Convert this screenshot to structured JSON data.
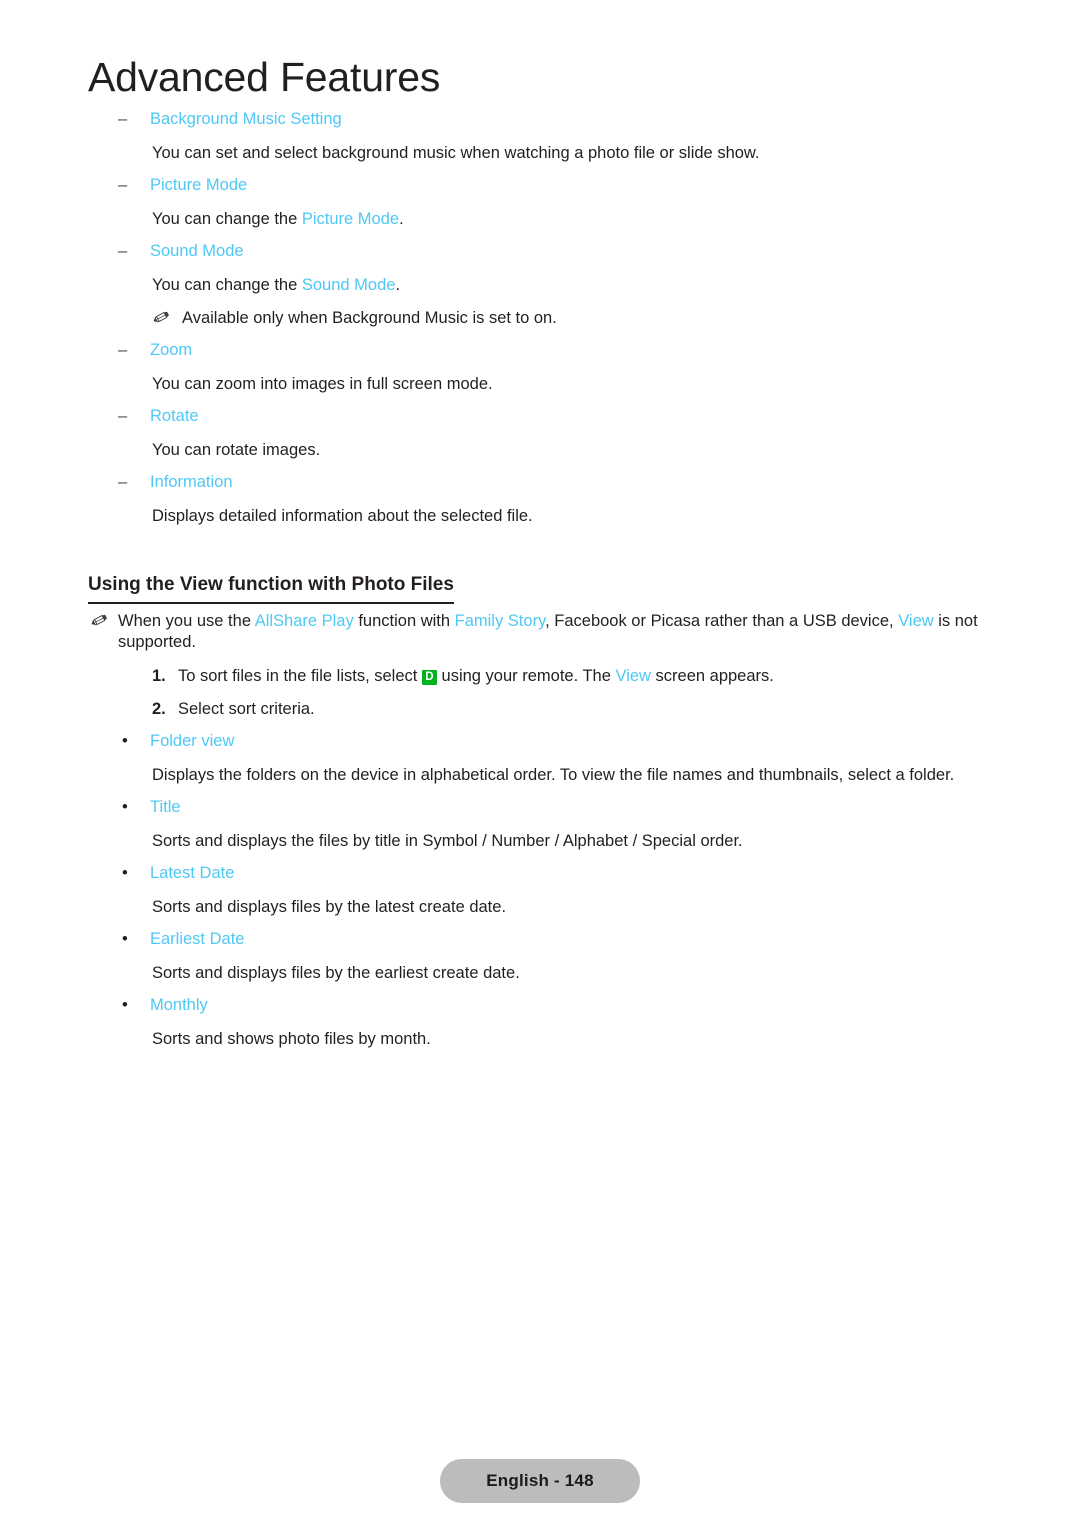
{
  "chapter": {
    "title": "Advanced Features"
  },
  "colors": {
    "accent_cyan": "#4ec8f4",
    "text": "#231f20",
    "key_chip_green": "#00b21e",
    "footer_pill": "#bcbcbc"
  },
  "options": [
    {
      "marker": "–",
      "label": "Background Music Setting",
      "description": "You can set and select background music when watching a photo file or slide show."
    },
    {
      "marker": "–",
      "label": "Picture Mode",
      "description_pre": "You can change the ",
      "description_link": "Picture Mode",
      "description_post": "."
    },
    {
      "marker": "–",
      "label": "Sound Mode",
      "description_pre": "You can change the ",
      "description_link": "Sound Mode",
      "description_post": ".",
      "note": "Available only when Background Music is set to on."
    },
    {
      "marker": "–",
      "label": "Zoom",
      "description": "You can zoom into images in full screen mode."
    },
    {
      "marker": "–",
      "label": "Rotate",
      "description": "You can rotate images."
    },
    {
      "marker": "–",
      "label": "Information",
      "description": "Displays detailed information about the selected file."
    }
  ],
  "section": {
    "heading": "Using the View function with Photo Files",
    "note": {
      "part1": "When you use the ",
      "link1": "AllShare Play",
      "part2": " function with ",
      "link2": "Family Story",
      "part3": ", Facebook or Picasa rather than a USB device, ",
      "link3": "View",
      "part4": " is not supported."
    },
    "steps": [
      {
        "number": "1.",
        "part1": "To sort files in the file lists, select ",
        "key": "D",
        "part2": " using your remote. The ",
        "link": "View",
        "part3": " screen appears."
      },
      {
        "number": "2.",
        "text": "Select sort criteria."
      }
    ],
    "sort_options": [
      {
        "marker": "•",
        "label": "Folder view",
        "description": "Displays the folders on the device in alphabetical order. To view the file names and thumbnails, select a folder."
      },
      {
        "marker": "•",
        "label": "Title",
        "description": "Sorts and displays the files by title in Symbol / Number / Alphabet / Special order."
      },
      {
        "marker": "•",
        "label": "Latest Date",
        "description": "Sorts and displays files by the latest create date."
      },
      {
        "marker": "•",
        "label": "Earliest Date",
        "description": "Sorts and displays files by the earliest create date."
      },
      {
        "marker": "•",
        "label": "Monthly",
        "description": "Sorts and shows photo files by month."
      }
    ]
  },
  "footer": {
    "label": "English - 148"
  }
}
